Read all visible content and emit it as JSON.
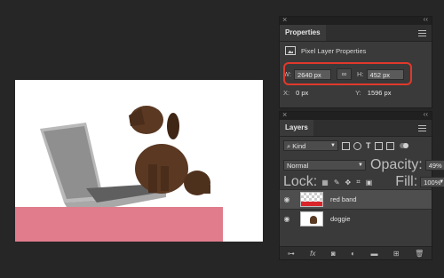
{
  "properties": {
    "tab": "Properties",
    "subtitle": "Pixel Layer Properties",
    "w_label": "W:",
    "w_value": "2640 px",
    "h_label": "H:",
    "h_value": "452 px",
    "x_label": "X:",
    "x_value": "0 px",
    "y_label": "Y:",
    "y_value": "1596 px"
  },
  "layers": {
    "tab": "Layers",
    "filter": "Kind",
    "blend": "Normal",
    "opacity_label": "Opacity:",
    "opacity_value": "49%",
    "lock_label": "Lock:",
    "fill_label": "Fill:",
    "fill_value": "100%",
    "items": [
      {
        "name": "red band",
        "active": true
      },
      {
        "name": "doggie",
        "active": false
      }
    ]
  },
  "colors": {
    "highlight": "#e0392b",
    "red_band": "#e07c8b"
  },
  "icons": [
    "close-icon",
    "collapse-icon",
    "panel-menu-icon",
    "pixel-layer-icon",
    "link-icon",
    "eye-icon",
    "lock-icon",
    "link-layers-icon",
    "fx-icon",
    "mask-icon",
    "adjustment-icon",
    "folder-icon",
    "new-layer-icon",
    "trash-icon"
  ]
}
